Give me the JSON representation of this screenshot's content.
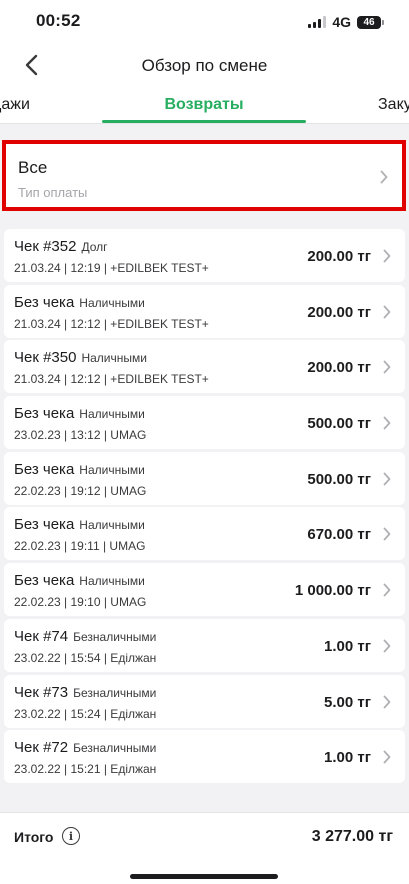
{
  "status_bar": {
    "time": "00:52",
    "network": "4G",
    "battery": "46"
  },
  "nav": {
    "title": "Обзор по смене"
  },
  "tabs": [
    {
      "label": "дажи"
    },
    {
      "label": "Возвраты"
    },
    {
      "label": "Заку"
    }
  ],
  "filter": {
    "title": "Все",
    "subtitle": "Тип оплаты"
  },
  "receipts": [
    {
      "title": "Чек #352",
      "payment": "Долг",
      "meta": "21.03.24 | 12:19 | +EDILBEK TEST+",
      "amount": "200.00 тг"
    },
    {
      "title": "Без чека",
      "payment": "Наличными",
      "meta": "21.03.24 | 12:12 | +EDILBEK TEST+",
      "amount": "200.00 тг"
    },
    {
      "title": "Чек #350",
      "payment": "Наличными",
      "meta": "21.03.24 | 12:12 | +EDILBEK TEST+",
      "amount": "200.00 тг"
    },
    {
      "title": "Без чека",
      "payment": "Наличными",
      "meta": "23.02.23 | 13:12 | UMAG",
      "amount": "500.00 тг"
    },
    {
      "title": "Без чека",
      "payment": "Наличными",
      "meta": "22.02.23 | 19:12 | UMAG",
      "amount": "500.00 тг"
    },
    {
      "title": "Без чека",
      "payment": "Наличными",
      "meta": "22.02.23 | 19:11 | UMAG",
      "amount": "670.00 тг"
    },
    {
      "title": "Без чека",
      "payment": "Наличными",
      "meta": "22.02.23 | 19:10 | UMAG",
      "amount": "1 000.00 тг"
    },
    {
      "title": "Чек #74",
      "payment": "Безналичными",
      "meta": "23.02.22 | 15:54 | Еділжан",
      "amount": "1.00 тг"
    },
    {
      "title": "Чек #73",
      "payment": "Безналичными",
      "meta": "23.02.22 | 15:24 | Еділжан",
      "amount": "5.00 тг"
    },
    {
      "title": "Чек #72",
      "payment": "Безналичными",
      "meta": "23.02.22 | 15:21 | Еділжан",
      "amount": "1.00 тг"
    }
  ],
  "footer": {
    "total_label": "Итого",
    "info_glyph": "i",
    "total_amount": "3 277.00 тг"
  },
  "colors": {
    "accent": "#27ae60",
    "highlight": "#e00000"
  }
}
